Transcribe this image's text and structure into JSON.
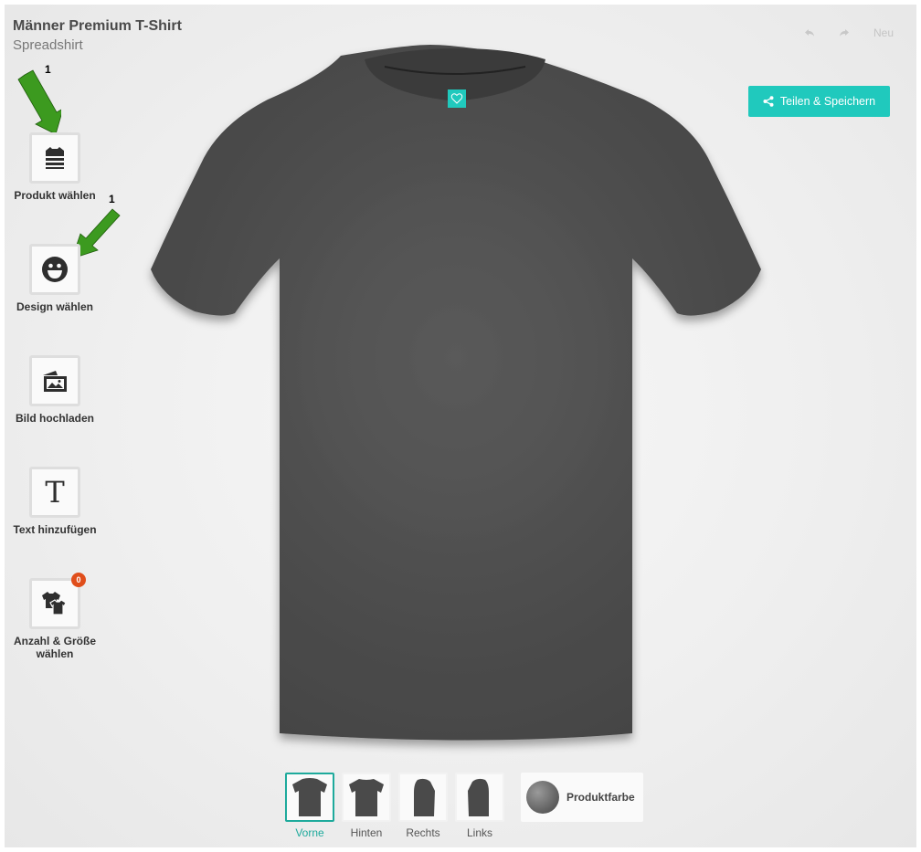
{
  "header": {
    "title": "Männer Premium T-Shirt",
    "subtitle": "Spreadshirt"
  },
  "top_controls": {
    "undo_icon": "undo-icon",
    "redo_icon": "redo-icon",
    "new_label": "Neu"
  },
  "share_button": {
    "label": "Teilen & Speichern",
    "icon": "share-icon",
    "color": "#20c9bd"
  },
  "annotations": {
    "arrow_1": "1",
    "arrow_2": "1",
    "arrow_color": "#3c9a1f"
  },
  "tools": [
    {
      "label": "Produkt wählen",
      "icon": "stacked-shirts-icon"
    },
    {
      "label": "Design wählen",
      "icon": "smiley-icon"
    },
    {
      "label": "Bild hochladen",
      "icon": "image-upload-icon"
    },
    {
      "label": "Text hinzufügen",
      "icon": "text-icon",
      "glyph": "T"
    },
    {
      "label": "Anzahl & Größe wählen",
      "icon": "shirts-size-icon",
      "badge": "0"
    }
  ],
  "product": {
    "name": "t-shirt",
    "color": "#4f4f4f",
    "logo_icon": "heart-icon"
  },
  "views": [
    {
      "label": "Vorne",
      "active": true
    },
    {
      "label": "Hinten",
      "active": false
    },
    {
      "label": "Rechts",
      "active": false
    },
    {
      "label": "Links",
      "active": false
    }
  ],
  "product_color": {
    "label": "Produktfarbe"
  },
  "colors": {
    "accent": "#20c9bd",
    "active_view": "#1eaa9c",
    "badge": "#e04e1b"
  }
}
